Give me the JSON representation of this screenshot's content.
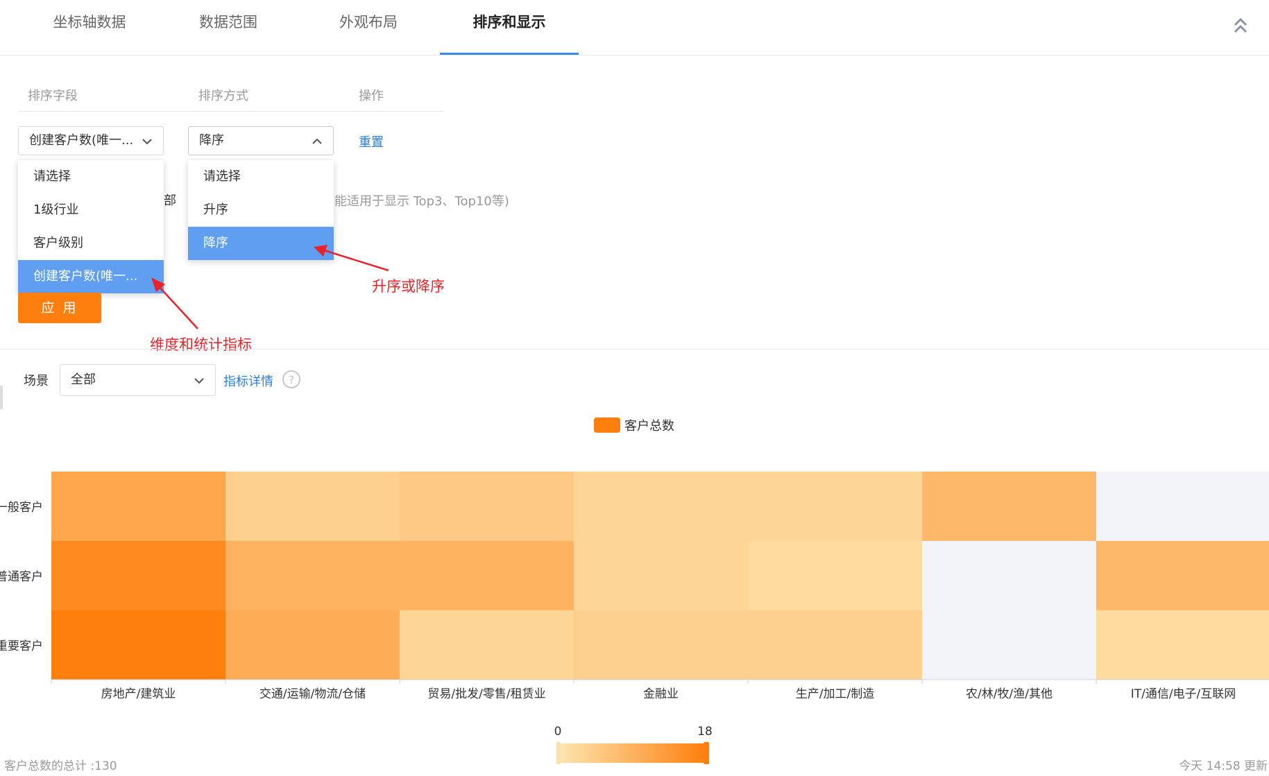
{
  "tabs": [
    {
      "label": "坐标轴数据",
      "active": false
    },
    {
      "label": "数据范围",
      "active": false
    },
    {
      "label": "外观布局",
      "active": false
    },
    {
      "label": "排序和显示",
      "active": true
    }
  ],
  "sort": {
    "headers": {
      "field": "排序字段",
      "method": "排序方式",
      "action": "操作"
    },
    "field_value": "创建客户数(唯一...",
    "method_value": "降序",
    "reset_label": "重置",
    "field_options": [
      "请选择",
      "1级行业",
      "客户级别",
      "创建客户数(唯一..."
    ],
    "field_selected_index": 3,
    "method_options": [
      "请选择",
      "升序",
      "降序"
    ],
    "method_selected_index": 2,
    "hidden_partial_text": "部",
    "hidden_hint_text": "能适用于显示 Top3、Top10等)",
    "apply_label": "应 用"
  },
  "annotations": {
    "method": "升序或降序",
    "field": "维度和统计指标"
  },
  "scene": {
    "label": "场景",
    "value": "全部",
    "detail_link": "指标详情"
  },
  "legend": {
    "label": "客户总数",
    "color": "#ff7f0e"
  },
  "chart_data": {
    "type": "heatmap",
    "x_categories": [
      "房地产/建筑业",
      "交通/运输/物流/仓储",
      "贸易/批发/零售/租赁业",
      "金融业",
      "生产/加工/制造",
      "农/林/牧/渔/其他",
      "IT/通信/电子/互联网"
    ],
    "y_categories": [
      "一般客户",
      "普通客户",
      "重要客户"
    ],
    "y_display": [
      "一般客户",
      "普通客户",
      "重要客户"
    ],
    "values": [
      [
        11,
        4,
        5,
        3,
        3,
        8,
        0
      ],
      [
        16,
        9,
        9,
        3,
        2,
        0,
        8
      ],
      [
        18,
        10,
        3,
        4,
        4,
        0,
        2
      ]
    ],
    "range": [
      0,
      18
    ],
    "color_min": "#fde6b1",
    "color_max": "#ff7f0e",
    "empty_color": "#f3f4f9",
    "visual_map": {
      "min_label": "0",
      "max_label": "18"
    }
  },
  "footer": {
    "total": "客户总数的总计 :130",
    "updated": "今天 14:58 更新"
  }
}
